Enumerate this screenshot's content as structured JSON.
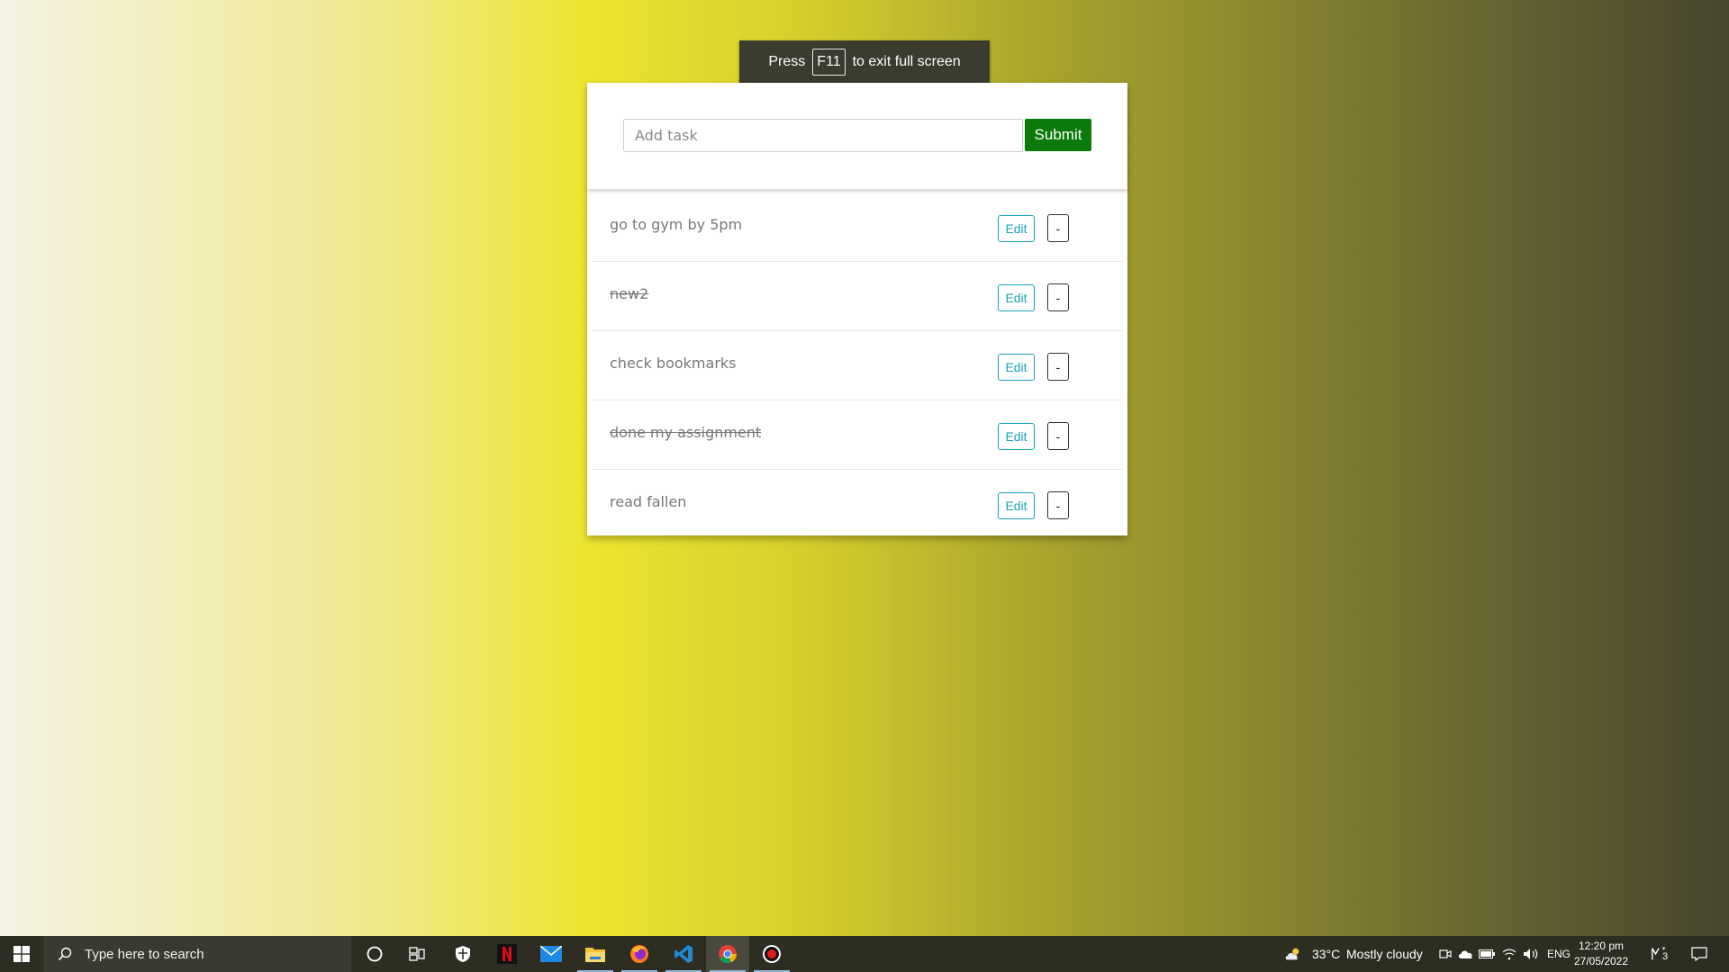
{
  "fullscreen_hint": {
    "prefix": "Press",
    "key": "F11",
    "suffix": "to exit full screen"
  },
  "todo": {
    "input": {
      "placeholder": "Add task",
      "value": ""
    },
    "submit_label": "Submit",
    "edit_label": "Edit",
    "remove_label": "-",
    "tasks": [
      {
        "text": "go to gym by 5pm",
        "done": false
      },
      {
        "text": "new2",
        "done": true
      },
      {
        "text": "check bookmarks",
        "done": false
      },
      {
        "text": "done my assignment",
        "done": true
      },
      {
        "text": "read fallen",
        "done": false
      }
    ]
  },
  "taskbar": {
    "search_placeholder": "Type here to search",
    "apps": [
      {
        "name": "cortana-icon",
        "running": false,
        "active": false
      },
      {
        "name": "task-view-icon",
        "running": false,
        "active": false
      },
      {
        "name": "security-icon",
        "running": false,
        "active": false
      },
      {
        "name": "netflix-icon",
        "running": false,
        "active": false
      },
      {
        "name": "mail-icon",
        "running": false,
        "active": false
      },
      {
        "name": "file-explorer-icon",
        "running": true,
        "active": false
      },
      {
        "name": "firefox-icon",
        "running": true,
        "active": false
      },
      {
        "name": "vscode-icon",
        "running": true,
        "active": false
      },
      {
        "name": "chrome-icon",
        "running": true,
        "active": true
      },
      {
        "name": "screen-recorder-icon",
        "running": true,
        "active": false
      }
    ],
    "weather": {
      "temperature": "33°C",
      "condition": "Mostly cloudy"
    },
    "language": "ENG",
    "time": "12:20 pm",
    "date": "27/05/2022",
    "notification_count": "3"
  },
  "colors": {
    "submit_bg": "#0a7a0a",
    "edit_accent": "#17a2b8",
    "taskbar_bg": "#2e2d22"
  }
}
